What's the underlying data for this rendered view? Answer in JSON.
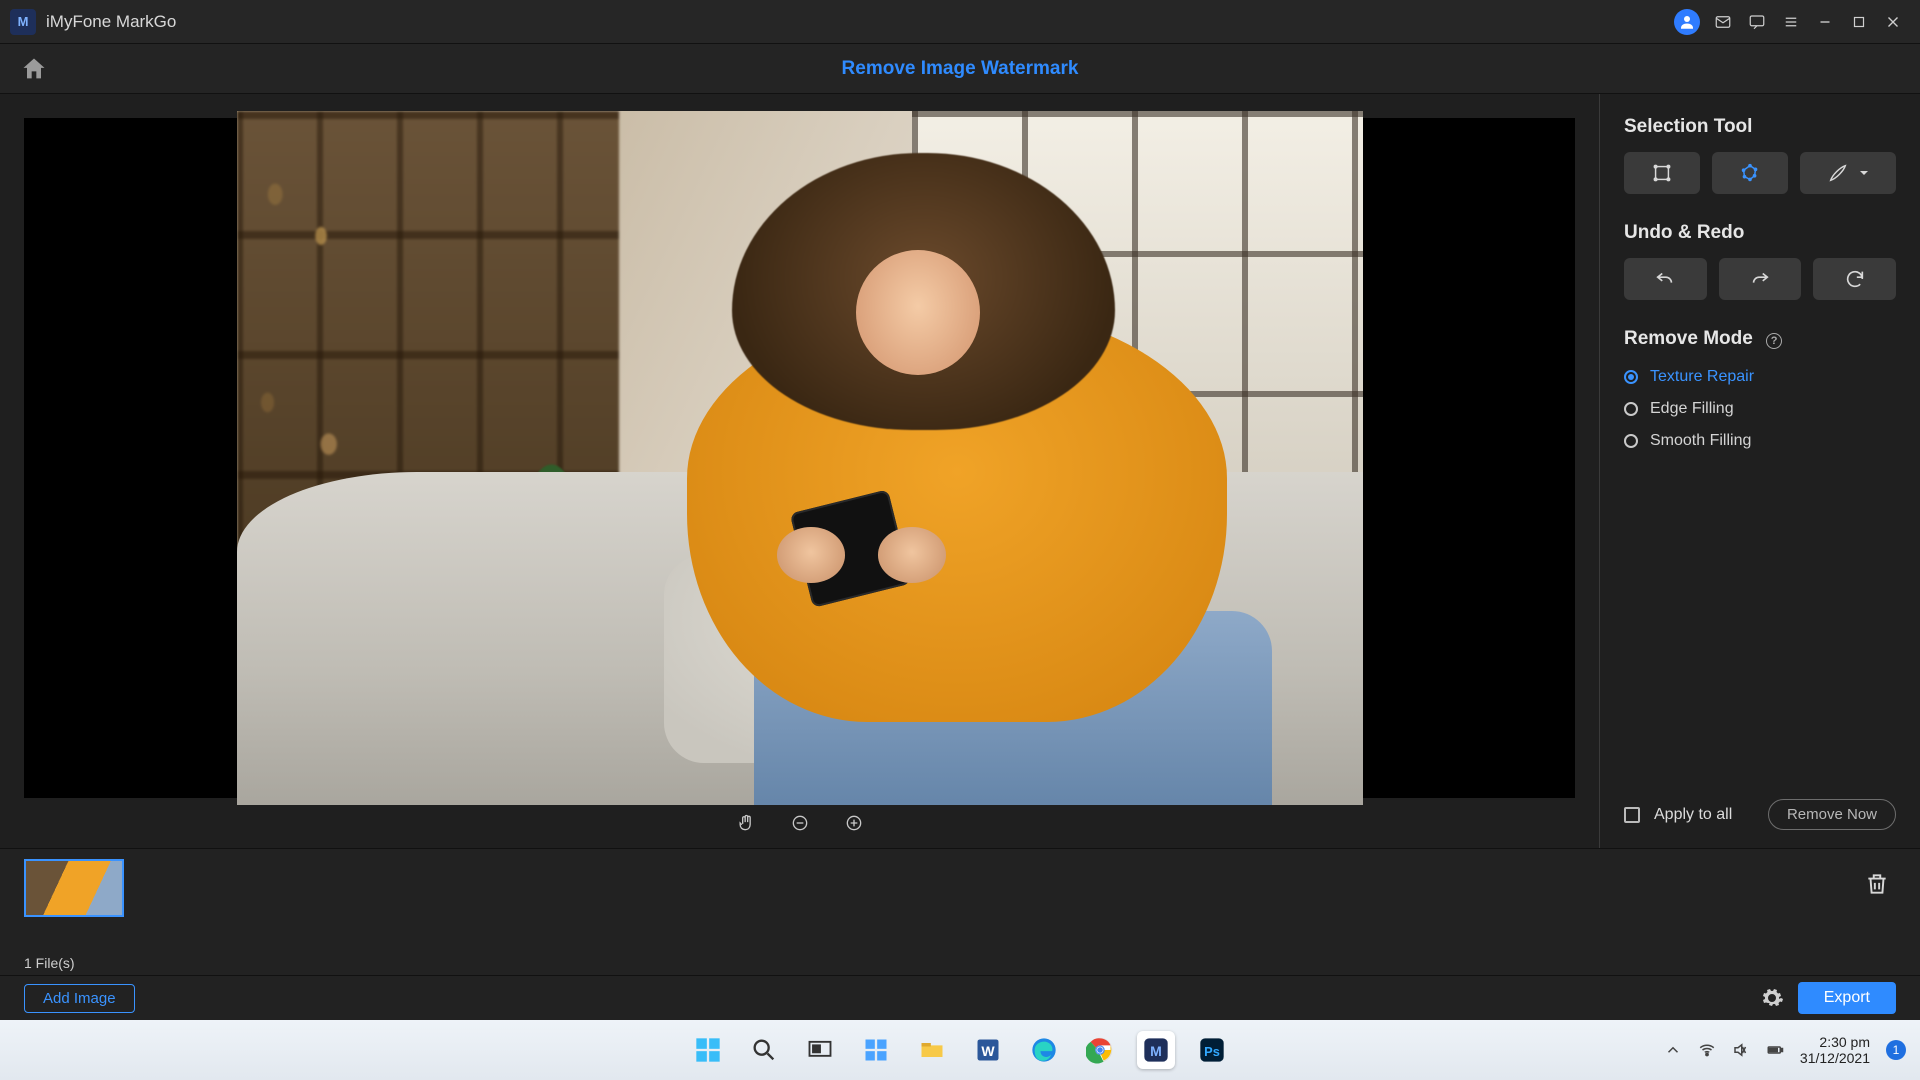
{
  "app": {
    "title": "iMyFone MarkGo"
  },
  "toolbar": {
    "active_tab": "Remove Image Watermark"
  },
  "canvas": {
    "controls": {
      "hand": "hand",
      "zoom_out": "zoom-out",
      "zoom_in": "zoom-in"
    }
  },
  "side": {
    "selection_label": "Selection Tool",
    "undo_label": "Undo & Redo",
    "remove_mode_label": "Remove Mode",
    "modes": {
      "texture": "Texture Repair",
      "edge": "Edge Filling",
      "smooth": "Smooth Filling"
    },
    "apply_all": "Apply to all",
    "remove_now": "Remove Now"
  },
  "thumb": {
    "file_count": "1 File(s)"
  },
  "footer": {
    "add_image": "Add Image",
    "export": "Export"
  },
  "tray": {
    "time": "2:30 pm",
    "date": "31/12/2021",
    "badge": "1"
  }
}
